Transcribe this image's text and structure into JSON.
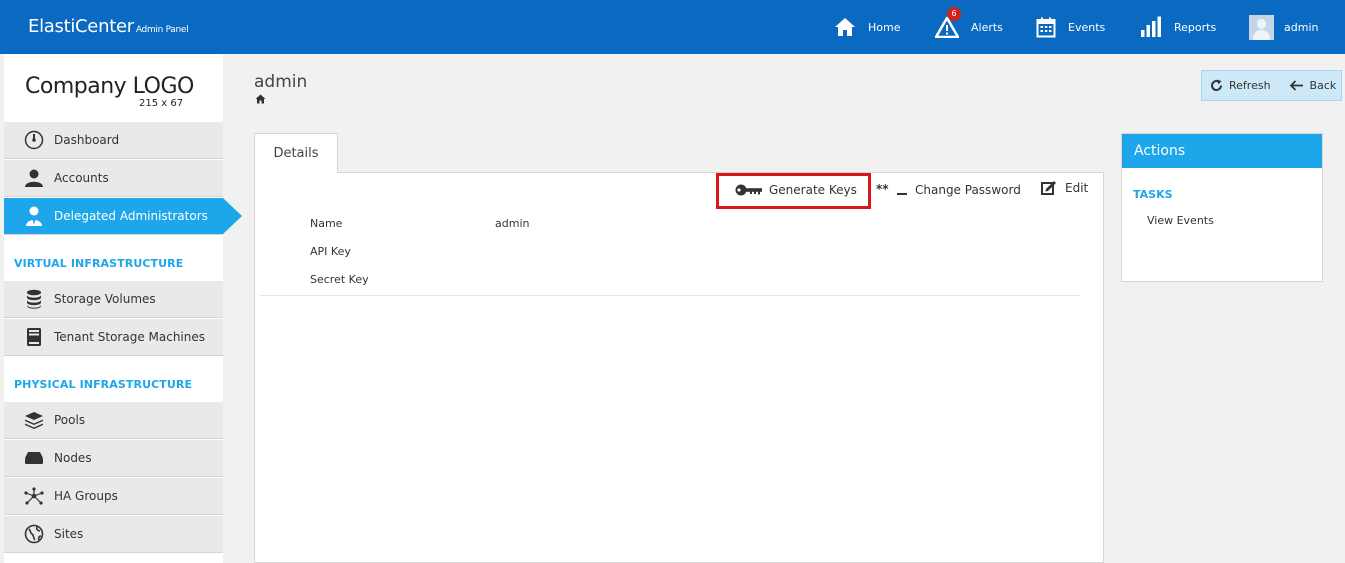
{
  "header": {
    "brand": "ElastiCenter",
    "brand_sub": "Admin Panel",
    "nav": [
      {
        "label": "Home",
        "icon": "home-icon"
      },
      {
        "label": "Alerts",
        "icon": "alert-icon",
        "badge": "6"
      },
      {
        "label": "Events",
        "icon": "calendar-icon"
      },
      {
        "label": "Reports",
        "icon": "bar-chart-icon"
      },
      {
        "label": "admin",
        "icon": "avatar"
      }
    ]
  },
  "sidebar": {
    "logo": "Company LOGO",
    "logo_size": "215 x 67",
    "items": [
      {
        "label": "Dashboard",
        "icon": "gauge-icon"
      },
      {
        "label": "Accounts",
        "icon": "user-icon"
      },
      {
        "label": "Delegated Administrators",
        "icon": "admin-user-icon",
        "active": true
      }
    ],
    "sections": [
      {
        "title": "VIRTUAL INFRASTRUCTURE",
        "items": [
          {
            "label": "Storage Volumes",
            "icon": "database-icon"
          },
          {
            "label": "Tenant Storage Machines",
            "icon": "server-icon"
          }
        ]
      },
      {
        "title": "PHYSICAL INFRASTRUCTURE",
        "items": [
          {
            "label": "Pools",
            "icon": "layers-icon"
          },
          {
            "label": "Nodes",
            "icon": "drive-icon"
          },
          {
            "label": "HA Groups",
            "icon": "network-icon"
          },
          {
            "label": "Sites",
            "icon": "globe-icon"
          }
        ]
      }
    ]
  },
  "main": {
    "title": "admin",
    "buttons": {
      "refresh": "Refresh",
      "back": "Back"
    },
    "tab": "Details",
    "actions": {
      "generate_keys": "Generate Keys",
      "change_password": "Change Password",
      "edit": "Edit"
    },
    "fields": [
      {
        "label": "Name",
        "value": "admin"
      },
      {
        "label": "API Key",
        "value": ""
      },
      {
        "label": "Secret Key",
        "value": ""
      }
    ]
  },
  "actions_panel": {
    "title": "Actions",
    "tasks_title": "TASKS",
    "tasks": [
      "View Events"
    ]
  },
  "colors": {
    "topbar": "#0a6ac1",
    "accent": "#1da6ea",
    "highlight": "#d9161a",
    "badge": "#d0221f"
  }
}
